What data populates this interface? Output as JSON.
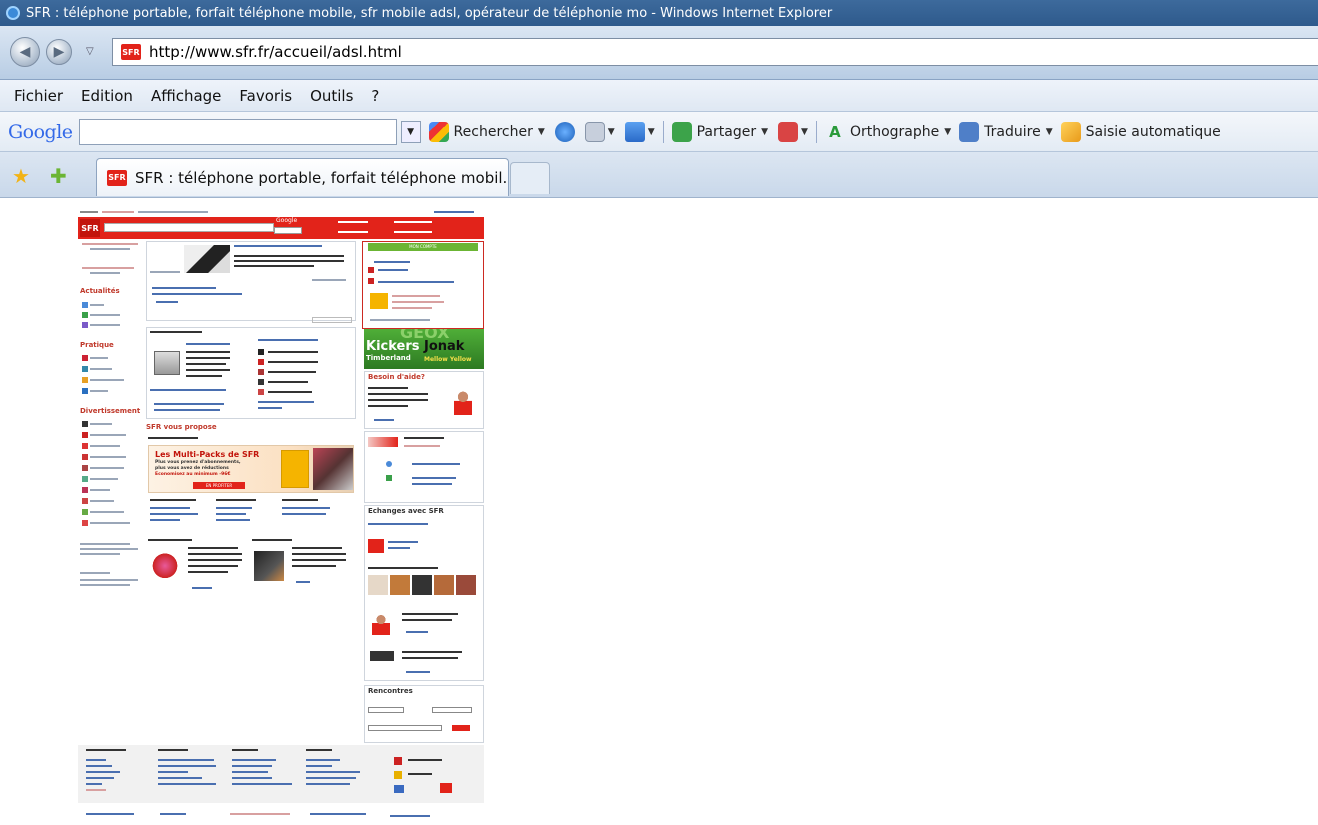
{
  "window": {
    "title": "SFR : téléphone portable, forfait téléphone mobile, sfr mobile adsl, opérateur de téléphonie mo - Windows Internet Explorer"
  },
  "address_bar": {
    "url": "http://www.sfr.fr/accueil/adsl.html",
    "site_icon_text": "SFR"
  },
  "menu": [
    "Fichier",
    "Edition",
    "Affichage",
    "Favoris",
    "Outils",
    "?"
  ],
  "google_toolbar": {
    "logo": "Google",
    "search_value": "",
    "buttons": [
      "Rechercher",
      "Partager",
      "Orthographe",
      "Traduire",
      "Saisie automatique"
    ]
  },
  "tabs": {
    "active_title": "SFR : téléphone portable, forfait téléphone mobil..."
  },
  "page": {
    "logo": "SFR",
    "search_brand": "Google",
    "left_sections": [
      "Actualités",
      "Pratique",
      "Divertissement"
    ],
    "center_heading": "SFR vous propose",
    "promo_title": "Les Multi-Packs de SFR",
    "promo_line1": "Plus vous prenez d'abonnements,",
    "promo_line2": "plus vous avez de réductions",
    "promo_line3": "Economisez au minimum -96€",
    "promo_button": "EN PROFITER",
    "ad_text_1": "Kickers",
    "ad_text_2": "Jonak",
    "ad_text_3": "Timberland",
    "ad_text_4": "Mellow Yellow",
    "ad_top": "GEOX",
    "help_heading": "Besoin d'aide?",
    "exchanges_heading": "Echanges avec SFR",
    "meet_heading": "Rencontres",
    "green_button": "MON COMPTE"
  }
}
